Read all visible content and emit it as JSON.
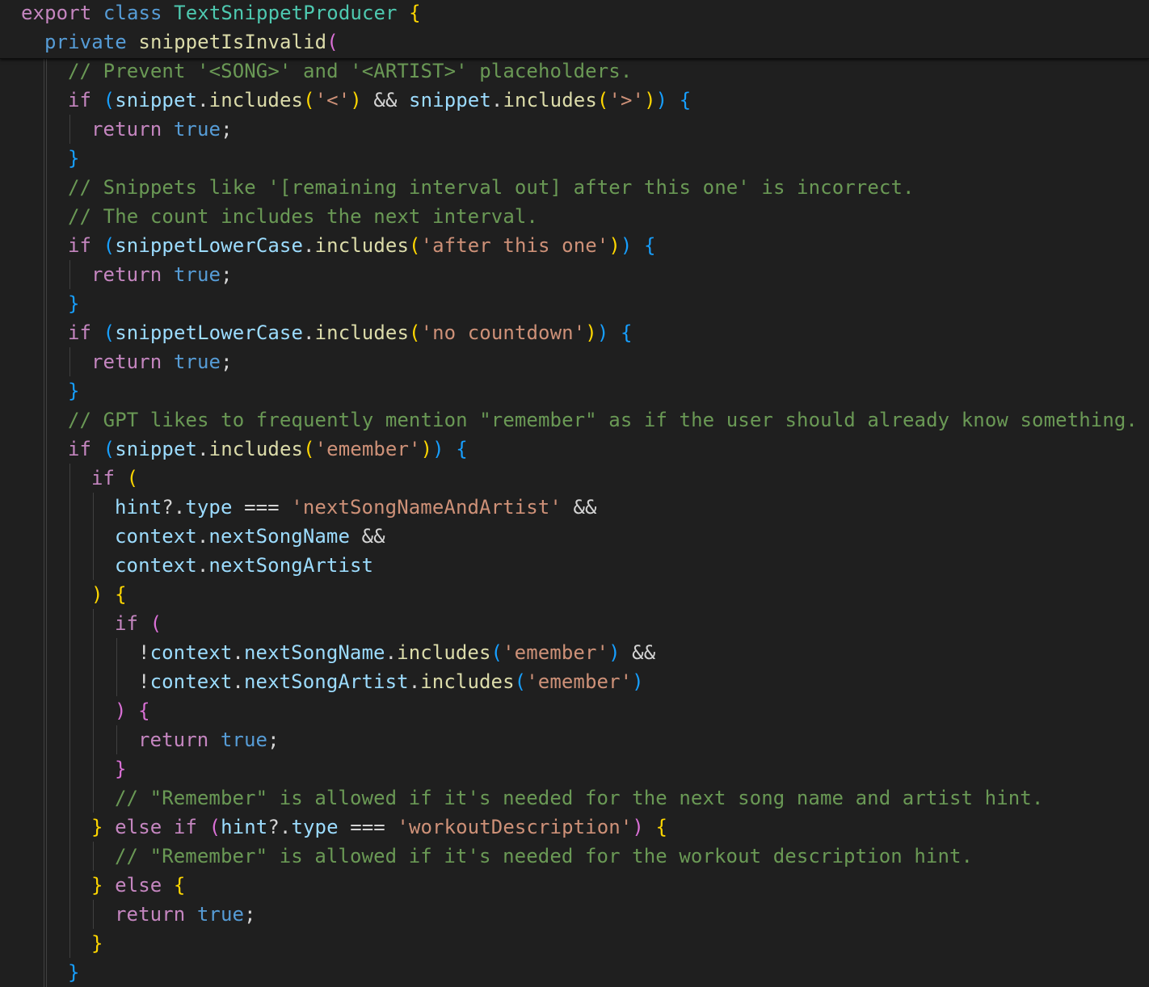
{
  "editor": {
    "theme": "Dark Modern",
    "colors": {
      "background": "#1f1f1f",
      "keyword": "#569cd6",
      "control": "#c586c0",
      "class": "#4ec9b0",
      "function": "#dcdcaa",
      "variable": "#9cdcfe",
      "string": "#ce9178",
      "comment": "#6a9955",
      "bracket_level_1": "#ffd700",
      "bracket_level_2": "#da70d6",
      "bracket_level_3": "#179fff"
    },
    "sticky_scroll": [
      {
        "indent": 0,
        "tokens": [
          [
            "export",
            "ctl"
          ],
          [
            " ",
            "op"
          ],
          [
            "class",
            "kw"
          ],
          [
            " ",
            "op"
          ],
          [
            "TextSnippetProducer",
            "cls"
          ],
          [
            " ",
            "op"
          ],
          [
            "{",
            "b1"
          ]
        ]
      },
      {
        "indent": 1,
        "tokens": [
          [
            "private",
            "kw"
          ],
          [
            " ",
            "op"
          ],
          [
            "snippetIsInvalid",
            "fn"
          ],
          [
            "(",
            "b2"
          ]
        ]
      }
    ],
    "lines": [
      {
        "indent": 2,
        "tokens": [
          [
            "// Prevent '<SONG>' and '<ARTIST>' placeholders.",
            "com"
          ]
        ]
      },
      {
        "indent": 2,
        "tokens": [
          [
            "if",
            "ctl"
          ],
          [
            " ",
            "op"
          ],
          [
            "(",
            "b3"
          ],
          [
            "snippet",
            "var"
          ],
          [
            ".",
            "op"
          ],
          [
            "includes",
            "fn"
          ],
          [
            "(",
            "b1"
          ],
          [
            "'<'",
            "str"
          ],
          [
            ")",
            "b1"
          ],
          [
            " && ",
            "op"
          ],
          [
            "snippet",
            "var"
          ],
          [
            ".",
            "op"
          ],
          [
            "includes",
            "fn"
          ],
          [
            "(",
            "b1"
          ],
          [
            "'>'",
            "str"
          ],
          [
            ")",
            "b1"
          ],
          [
            ")",
            "b3"
          ],
          [
            " ",
            "op"
          ],
          [
            "{",
            "b3"
          ]
        ]
      },
      {
        "indent": 3,
        "tokens": [
          [
            "return",
            "ctl"
          ],
          [
            " ",
            "op"
          ],
          [
            "true",
            "kw"
          ],
          [
            ";",
            "op"
          ]
        ]
      },
      {
        "indent": 2,
        "tokens": [
          [
            "}",
            "b3"
          ]
        ]
      },
      {
        "indent": 2,
        "tokens": [
          [
            "// Snippets like '[remaining interval out] after this one' is incorrect.",
            "com"
          ]
        ]
      },
      {
        "indent": 2,
        "tokens": [
          [
            "// The count includes the next interval.",
            "com"
          ]
        ]
      },
      {
        "indent": 2,
        "tokens": [
          [
            "if",
            "ctl"
          ],
          [
            " ",
            "op"
          ],
          [
            "(",
            "b3"
          ],
          [
            "snippetLowerCase",
            "var"
          ],
          [
            ".",
            "op"
          ],
          [
            "includes",
            "fn"
          ],
          [
            "(",
            "b1"
          ],
          [
            "'after this one'",
            "str"
          ],
          [
            ")",
            "b1"
          ],
          [
            ")",
            "b3"
          ],
          [
            " ",
            "op"
          ],
          [
            "{",
            "b3"
          ]
        ]
      },
      {
        "indent": 3,
        "tokens": [
          [
            "return",
            "ctl"
          ],
          [
            " ",
            "op"
          ],
          [
            "true",
            "kw"
          ],
          [
            ";",
            "op"
          ]
        ]
      },
      {
        "indent": 2,
        "tokens": [
          [
            "}",
            "b3"
          ]
        ]
      },
      {
        "indent": 2,
        "tokens": [
          [
            "if",
            "ctl"
          ],
          [
            " ",
            "op"
          ],
          [
            "(",
            "b3"
          ],
          [
            "snippetLowerCase",
            "var"
          ],
          [
            ".",
            "op"
          ],
          [
            "includes",
            "fn"
          ],
          [
            "(",
            "b1"
          ],
          [
            "'no countdown'",
            "str"
          ],
          [
            ")",
            "b1"
          ],
          [
            ")",
            "b3"
          ],
          [
            " ",
            "op"
          ],
          [
            "{",
            "b3"
          ]
        ]
      },
      {
        "indent": 3,
        "tokens": [
          [
            "return",
            "ctl"
          ],
          [
            " ",
            "op"
          ],
          [
            "true",
            "kw"
          ],
          [
            ";",
            "op"
          ]
        ]
      },
      {
        "indent": 2,
        "tokens": [
          [
            "}",
            "b3"
          ]
        ]
      },
      {
        "indent": 2,
        "tokens": [
          [
            "// GPT likes to frequently mention \"remember\" as if the user should already know something.",
            "com"
          ]
        ]
      },
      {
        "indent": 2,
        "tokens": [
          [
            "if",
            "ctl"
          ],
          [
            " ",
            "op"
          ],
          [
            "(",
            "b3"
          ],
          [
            "snippet",
            "var"
          ],
          [
            ".",
            "op"
          ],
          [
            "includes",
            "fn"
          ],
          [
            "(",
            "b1"
          ],
          [
            "'emember'",
            "str"
          ],
          [
            ")",
            "b1"
          ],
          [
            ")",
            "b3"
          ],
          [
            " ",
            "op"
          ],
          [
            "{",
            "b3"
          ]
        ]
      },
      {
        "indent": 3,
        "tokens": [
          [
            "if",
            "ctl"
          ],
          [
            " ",
            "op"
          ],
          [
            "(",
            "b1"
          ]
        ]
      },
      {
        "indent": 4,
        "tokens": [
          [
            "hint",
            "var"
          ],
          [
            "?.",
            "op"
          ],
          [
            "type",
            "var"
          ],
          [
            " === ",
            "op"
          ],
          [
            "'nextSongNameAndArtist'",
            "str"
          ],
          [
            " &&",
            "op"
          ]
        ]
      },
      {
        "indent": 4,
        "tokens": [
          [
            "context",
            "var"
          ],
          [
            ".",
            "op"
          ],
          [
            "nextSongName",
            "var"
          ],
          [
            " &&",
            "op"
          ]
        ]
      },
      {
        "indent": 4,
        "tokens": [
          [
            "context",
            "var"
          ],
          [
            ".",
            "op"
          ],
          [
            "nextSongArtist",
            "var"
          ]
        ]
      },
      {
        "indent": 3,
        "tokens": [
          [
            ")",
            "b1"
          ],
          [
            " ",
            "op"
          ],
          [
            "{",
            "b1"
          ]
        ]
      },
      {
        "indent": 4,
        "tokens": [
          [
            "if",
            "ctl"
          ],
          [
            " ",
            "op"
          ],
          [
            "(",
            "b2"
          ]
        ]
      },
      {
        "indent": 5,
        "tokens": [
          [
            "!",
            "op"
          ],
          [
            "context",
            "var"
          ],
          [
            ".",
            "op"
          ],
          [
            "nextSongName",
            "var"
          ],
          [
            ".",
            "op"
          ],
          [
            "includes",
            "fn"
          ],
          [
            "(",
            "b3"
          ],
          [
            "'emember'",
            "str"
          ],
          [
            ")",
            "b3"
          ],
          [
            " &&",
            "op"
          ]
        ]
      },
      {
        "indent": 5,
        "tokens": [
          [
            "!",
            "op"
          ],
          [
            "context",
            "var"
          ],
          [
            ".",
            "op"
          ],
          [
            "nextSongArtist",
            "var"
          ],
          [
            ".",
            "op"
          ],
          [
            "includes",
            "fn"
          ],
          [
            "(",
            "b3"
          ],
          [
            "'emember'",
            "str"
          ],
          [
            ")",
            "b3"
          ]
        ]
      },
      {
        "indent": 4,
        "tokens": [
          [
            ")",
            "b2"
          ],
          [
            " ",
            "op"
          ],
          [
            "{",
            "b2"
          ]
        ]
      },
      {
        "indent": 5,
        "tokens": [
          [
            "return",
            "ctl"
          ],
          [
            " ",
            "op"
          ],
          [
            "true",
            "kw"
          ],
          [
            ";",
            "op"
          ]
        ]
      },
      {
        "indent": 4,
        "tokens": [
          [
            "}",
            "b2"
          ]
        ]
      },
      {
        "indent": 4,
        "tokens": [
          [
            "// \"Remember\" is allowed if it's needed for the next song name and artist hint.",
            "com"
          ]
        ]
      },
      {
        "indent": 3,
        "tokens": [
          [
            "}",
            "b1"
          ],
          [
            " ",
            "op"
          ],
          [
            "else",
            "ctl"
          ],
          [
            " ",
            "op"
          ],
          [
            "if",
            "ctl"
          ],
          [
            " ",
            "op"
          ],
          [
            "(",
            "b2"
          ],
          [
            "hint",
            "var"
          ],
          [
            "?.",
            "op"
          ],
          [
            "type",
            "var"
          ],
          [
            " === ",
            "op"
          ],
          [
            "'workoutDescription'",
            "str"
          ],
          [
            ")",
            "b2"
          ],
          [
            " ",
            "op"
          ],
          [
            "{",
            "b1"
          ]
        ]
      },
      {
        "indent": 4,
        "tokens": [
          [
            "// \"Remember\" is allowed if it's needed for the workout description hint.",
            "com"
          ]
        ]
      },
      {
        "indent": 3,
        "tokens": [
          [
            "}",
            "b1"
          ],
          [
            " ",
            "op"
          ],
          [
            "else",
            "ctl"
          ],
          [
            " ",
            "op"
          ],
          [
            "{",
            "b1"
          ]
        ]
      },
      {
        "indent": 4,
        "tokens": [
          [
            "return",
            "ctl"
          ],
          [
            " ",
            "op"
          ],
          [
            "true",
            "kw"
          ],
          [
            ";",
            "op"
          ]
        ]
      },
      {
        "indent": 3,
        "tokens": [
          [
            "}",
            "b1"
          ]
        ]
      },
      {
        "indent": 2,
        "tokens": [
          [
            "}",
            "b3"
          ]
        ]
      }
    ]
  }
}
